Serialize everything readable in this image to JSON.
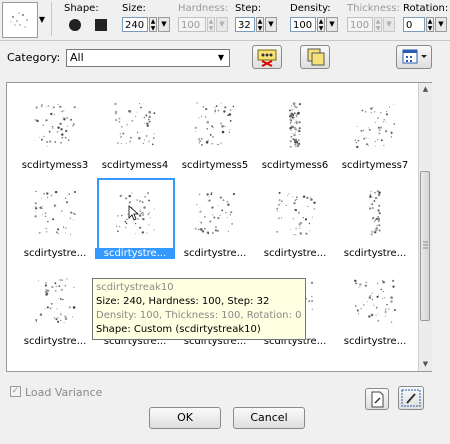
{
  "toolbar": {
    "shape_label": "Shape:",
    "size_label": "Size:",
    "size_value": "240",
    "hardness_label": "Hardness:",
    "hardness_value": "100",
    "step_label": "Step:",
    "step_value": "32",
    "density_label": "Density:",
    "density_value": "100",
    "thickness_label": "Thickness:",
    "thickness_value": "100",
    "rotation_label": "Rotation:",
    "rotation_value": "0"
  },
  "category": {
    "label": "Category:",
    "value": "All"
  },
  "brushes": [
    {
      "name": "scdirtymess3"
    },
    {
      "name": "scdirtymess4"
    },
    {
      "name": "scdirtymess5"
    },
    {
      "name": "scdirtymess6"
    },
    {
      "name": "scdirtymess7"
    },
    {
      "name": "scdirtystre..."
    },
    {
      "name": "scdirtystre...",
      "selected": true
    },
    {
      "name": "scdirtystre..."
    },
    {
      "name": "scdirtystre..."
    },
    {
      "name": "scdirtystre..."
    },
    {
      "name": "scdirtystre..."
    },
    {
      "name": "scdirtystre..."
    },
    {
      "name": "scdirtystre..."
    },
    {
      "name": "scdirtystre..."
    },
    {
      "name": "scdirtystre..."
    }
  ],
  "tooltip": {
    "title": "scdirtystreak10",
    "line1": "Size: 240, Hardness: 100, Step: 32",
    "line2": "Density: 100, Thickness: 100, Rotation: 0",
    "line3": "Shape: Custom (scdirtystreak10)"
  },
  "bottom": {
    "load_variance_label": "Load Variance",
    "ok_label": "OK",
    "cancel_label": "Cancel"
  },
  "colors": {
    "selection": "#3399ff",
    "tooltip_bg": "#ffffe1"
  }
}
